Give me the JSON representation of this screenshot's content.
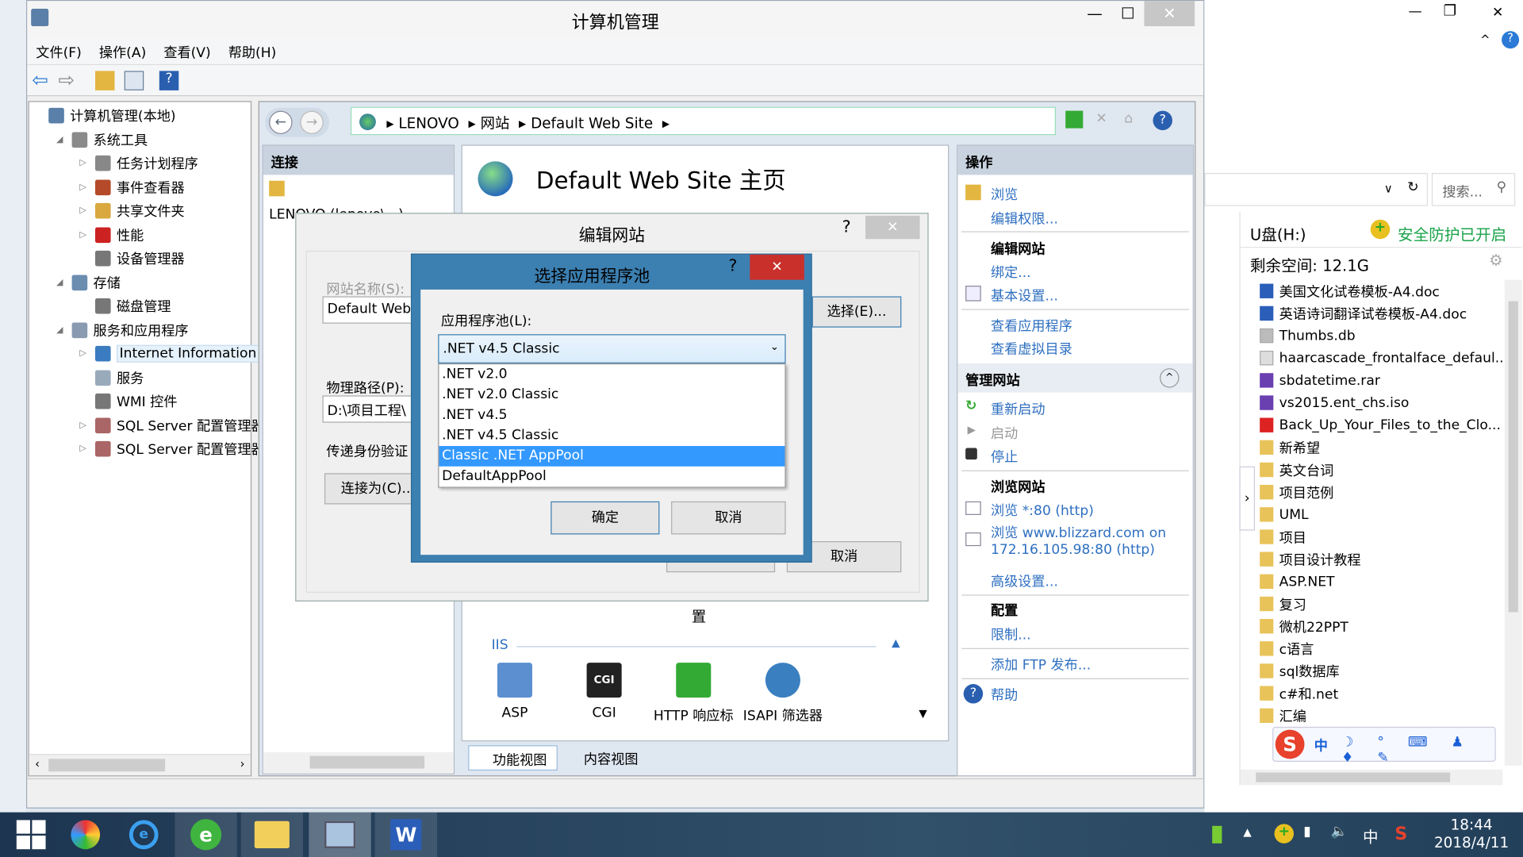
{
  "window": {
    "title": "计算机管理",
    "minimize": "—",
    "maximize": "☐",
    "close": "✕"
  },
  "menu": [
    "文件(F)",
    "操作(A)",
    "查看(V)",
    "帮助(H)"
  ],
  "tree": [
    {
      "label": "计算机管理(本地)",
      "level": 0,
      "arrow": "",
      "icon": "#5a7fa8"
    },
    {
      "label": "系统工具",
      "level": 1,
      "arrow": "◢",
      "icon": "#8a8a8a"
    },
    {
      "label": "任务计划程序",
      "level": 2,
      "arrow": "▷",
      "icon": "#888"
    },
    {
      "label": "事件查看器",
      "level": 2,
      "arrow": "▷",
      "icon": "#b54a2a"
    },
    {
      "label": "共享文件夹",
      "level": 2,
      "arrow": "▷",
      "icon": "#d9a940"
    },
    {
      "label": "性能",
      "level": 2,
      "arrow": "▷",
      "icon": "#c22"
    },
    {
      "label": "设备管理器",
      "level": 2,
      "arrow": "",
      "icon": "#777"
    },
    {
      "label": "存储",
      "level": 1,
      "arrow": "◢",
      "icon": "#6a8db0"
    },
    {
      "label": "磁盘管理",
      "level": 2,
      "arrow": "",
      "icon": "#777"
    },
    {
      "label": "服务和应用程序",
      "level": 1,
      "arrow": "◢",
      "icon": "#8a9ab0"
    },
    {
      "label": "Internet Information S",
      "level": 2,
      "arrow": "▷",
      "icon": "#3b7bbf",
      "selected": true
    },
    {
      "label": "服务",
      "level": 2,
      "arrow": "",
      "icon": "#9ab"
    },
    {
      "label": "WMI 控件",
      "level": 2,
      "arrow": "",
      "icon": "#777"
    },
    {
      "label": "SQL Server 配置管理器",
      "level": 2,
      "arrow": "▷",
      "icon": "#a66"
    },
    {
      "label": "SQL Server 配置管理器",
      "level": 2,
      "arrow": "▷",
      "icon": "#a66"
    }
  ],
  "iis": {
    "breadcrumb": [
      "LENOVO",
      "网站",
      "Default Web Site"
    ],
    "connections_title": "连接",
    "connections_node": "LENOVO (lenovo\\...)",
    "page_title": "Default Web Site 主页",
    "section_iis": "IIS",
    "section_partial": "置",
    "features": [
      {
        "label": "ASP",
        "icon": "asp-icon"
      },
      {
        "label": "CGI",
        "icon": "cgi-icon"
      },
      {
        "label": "HTTP 响应标",
        "icon": "http-response-icon"
      },
      {
        "label": "ISAPI 筛选器",
        "icon": "isapi-filter-icon"
      }
    ],
    "tabs": {
      "features_view": "功能视图",
      "content_view": "内容视图"
    },
    "actions": {
      "title": "操作",
      "browse": "浏览",
      "edit_permissions": "编辑权限...",
      "edit_site": "编辑网站",
      "bindings": "绑定...",
      "basic_settings": "基本设置...",
      "view_apps": "查看应用程序",
      "view_vdirs": "查看虚拟目录",
      "manage_site": "管理网站",
      "restart": "重新启动",
      "start": "启动",
      "stop": "停止",
      "browse_site": "浏览网站",
      "browse_80": "浏览 *:80 (http)",
      "browse_blizzard": "浏览 www.blizzard.com on",
      "browse_blizzard2": "172.16.105.98:80 (http)",
      "advanced": "高级设置...",
      "config": "配置",
      "limits": "限制...",
      "add_ftp": "添加 FTP 发布...",
      "help": "帮助"
    }
  },
  "edit_site_dialog": {
    "title": "编辑网站",
    "help": "?",
    "close": "✕",
    "site_name_label": "网站名称(S):",
    "site_name_value": "Default Web",
    "select_button": "选择(E)...",
    "physical_path_label": "物理路径(P):",
    "physical_path_value": "D:\\项目工程\\",
    "pass_auth_label": "传递身份验证",
    "connect_as_button": "连接为(C)...",
    "cancel": "取消"
  },
  "app_pool_dialog": {
    "title": "选择应用程序池",
    "help": "?",
    "close": "✕",
    "label": "应用程序池(L):",
    "selected": ".NET v4.5 Classic",
    "options": [
      ".NET v2.0",
      ".NET v2.0 Classic",
      ".NET v4.5",
      ".NET v4.5 Classic",
      "Classic .NET AppPool",
      "DefaultAppPool"
    ],
    "highlighted_index": 4,
    "ok": "确定",
    "cancel": "取消"
  },
  "explorer": {
    "search_placeholder": "搜索...",
    "drive": "U盘(H:)",
    "protection": "安全防护已开启",
    "free_space": "剩余空间: 12.1G",
    "files": [
      {
        "name": "美国文化试卷模板-A4.doc",
        "type": "doc"
      },
      {
        "name": "英语诗词翻译试卷模板-A4.doc",
        "type": "doc"
      },
      {
        "name": "Thumbs.db",
        "type": "db"
      },
      {
        "name": "haarcascade_frontalface_defaul...",
        "type": "file"
      },
      {
        "name": "sbdatetime.rar",
        "type": "rar"
      },
      {
        "name": "vs2015.ent_chs.iso",
        "type": "rar"
      },
      {
        "name": "Back_Up_Your_Files_to_the_Clo...",
        "type": "pdf"
      },
      {
        "name": "新希望",
        "type": "folder"
      },
      {
        "name": "英文台词",
        "type": "folder"
      },
      {
        "name": "项目范例",
        "type": "folder"
      },
      {
        "name": "UML",
        "type": "folder"
      },
      {
        "name": "项目",
        "type": "folder"
      },
      {
        "name": "项目设计教程",
        "type": "folder"
      },
      {
        "name": "ASP.NET",
        "type": "folder"
      },
      {
        "name": "复习",
        "type": "folder"
      },
      {
        "name": "微机22PPT",
        "type": "folder"
      },
      {
        "name": "c语言",
        "type": "folder"
      },
      {
        "name": "sql数据库",
        "type": "folder"
      },
      {
        "name": "c#和.net",
        "type": "folder"
      },
      {
        "name": "汇编",
        "type": "folder"
      }
    ]
  },
  "ime": {
    "mode": "中"
  },
  "taskbar": {
    "time": "18:44",
    "date": "2018/4/11",
    "ime": "中"
  },
  "colors": {
    "accent": "#3399ff",
    "dialog_frame": "#3c7fb1",
    "close_red": "#c9302c",
    "link": "#2e6fc0"
  }
}
